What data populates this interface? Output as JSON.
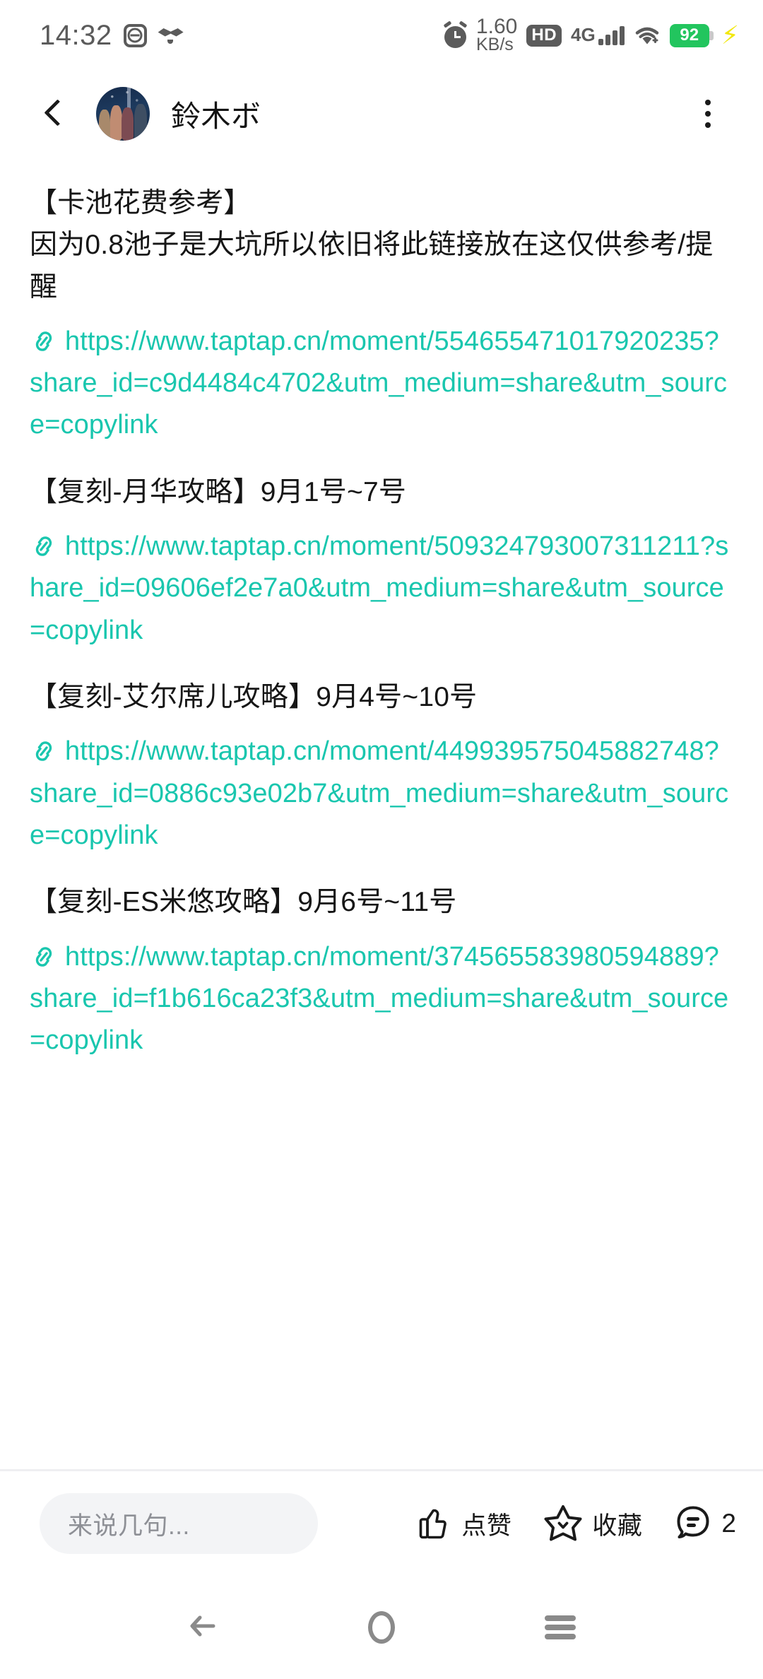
{
  "status_bar": {
    "clock": "14:32",
    "net_speed_value": "1.60",
    "net_speed_unit": "KB/s",
    "hd_badge": "HD",
    "network_type": "4G",
    "battery_percent": "92",
    "icons": [
      "app-badge-icon",
      "app-blob-icon",
      "alarm-icon",
      "net-speed-icon",
      "hd-icon",
      "signal-4g-icon",
      "wifi-icon",
      "battery-icon",
      "charging-bolt-icon"
    ]
  },
  "header": {
    "back_label": "back-chevron",
    "username": "鈴木ボ",
    "menu_label": "more-options"
  },
  "post": {
    "blocks": [
      {
        "title": "【卡池花费参考】",
        "body": "因为0.8池子是大坑所以依旧将此链接放在这仅供参考/提醒",
        "link": "https://www.taptap.cn/moment/554655471017920235?share_id=c9d4484c4702&utm_medium=share&utm_source=copylink"
      },
      {
        "title": "【复刻-月华攻略】9月1号~7号",
        "body": "",
        "link": "https://www.taptap.cn/moment/509324793007311211?share_id=09606ef2e7a0&utm_medium=share&utm_source=copylink"
      },
      {
        "title": "【复刻-艾尔席儿攻略】9月4号~10号",
        "body": "",
        "link": "https://www.taptap.cn/moment/449939575045882748?share_id=0886c93e02b7&utm_medium=share&utm_source=copylink"
      },
      {
        "title": "【复刻-ES米悠攻略】9月6号~11号",
        "body": "",
        "link": "https://www.taptap.cn/moment/374565583980594889?share_id=f1b616ca23f3&utm_medium=share&utm_source=copylink"
      }
    ]
  },
  "action_bar": {
    "comment_placeholder": "来说几句...",
    "like_label": "点赞",
    "favorite_label": "收藏",
    "comment_count": "2"
  },
  "nav_bar": {
    "back": "back-arrow-icon",
    "home": "home-icon",
    "recents": "recents-icon"
  },
  "colors": {
    "link": "#19c6ae",
    "text": "#161616",
    "battery_green": "#22c55e",
    "status_gray": "#5b5b5b",
    "input_bg": "#f3f4f6"
  }
}
